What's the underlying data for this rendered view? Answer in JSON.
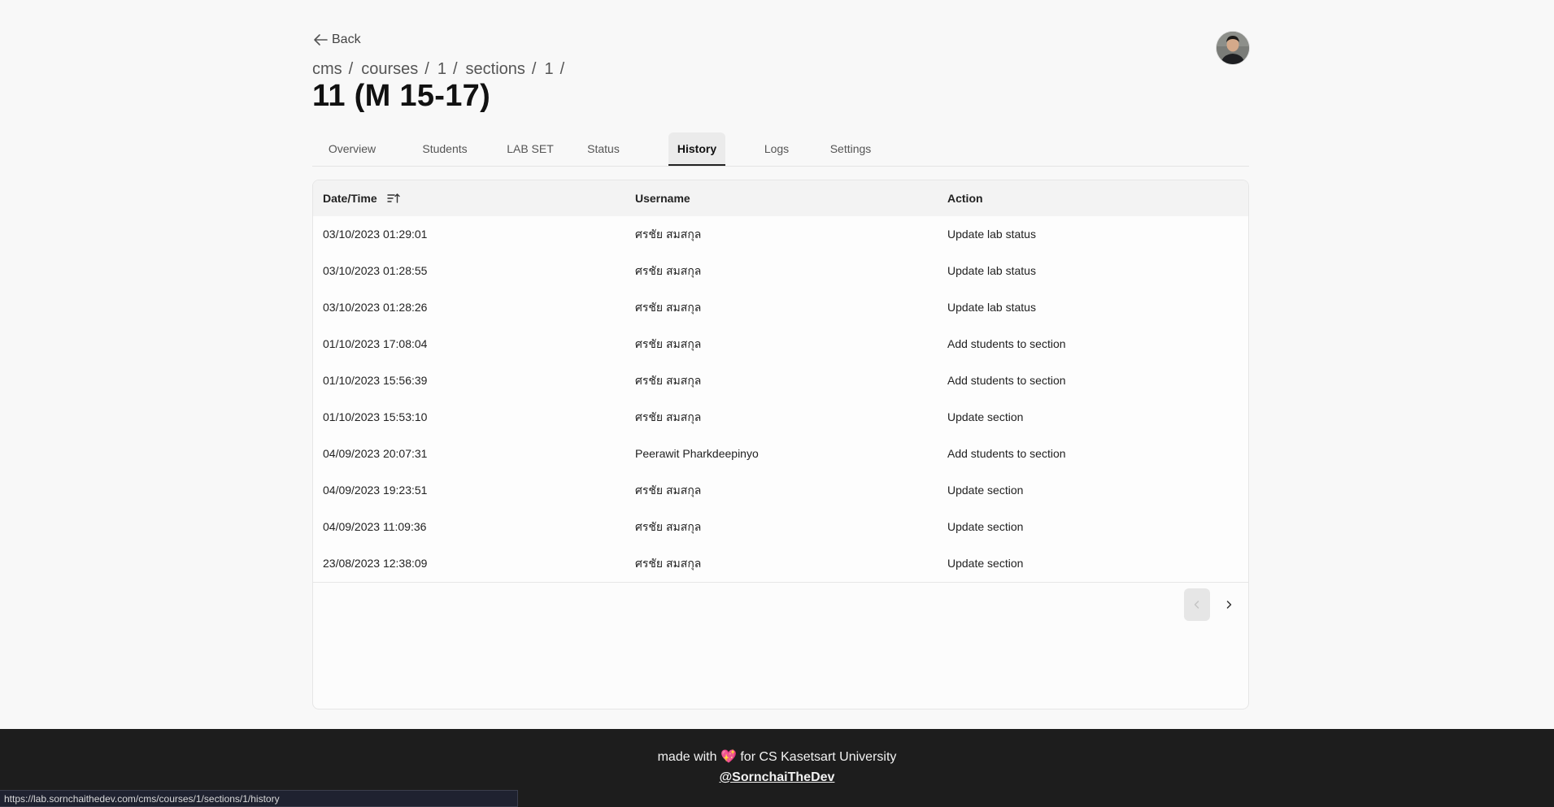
{
  "nav": {
    "back_label": "Back"
  },
  "breadcrumb": [
    {
      "label": "cms",
      "sep": "/"
    },
    {
      "label": "courses",
      "sep": "/"
    },
    {
      "label": "1",
      "sep": "/"
    },
    {
      "label": "sections",
      "sep": "/"
    },
    {
      "label": "1",
      "sep": "/"
    }
  ],
  "page_title": "11 (M 15-17)",
  "tabs": [
    {
      "label": "Overview",
      "active": false
    },
    {
      "label": "Students",
      "active": false
    },
    {
      "label": "LAB SET",
      "active": false
    },
    {
      "label": "Status",
      "active": false
    },
    {
      "label": "History",
      "active": true
    },
    {
      "label": "Logs",
      "active": false
    },
    {
      "label": "Settings",
      "active": false
    }
  ],
  "table": {
    "columns": [
      "Date/Time",
      "Username",
      "Action"
    ],
    "sort_icon": "sort-ascending-icon",
    "rows": [
      [
        "03/10/2023 01:29:01",
        "ศรชัย สมสกุล",
        "Update lab status"
      ],
      [
        "03/10/2023 01:28:55",
        "ศรชัย สมสกุล",
        "Update lab status"
      ],
      [
        "03/10/2023 01:28:26",
        "ศรชัย สมสกุล",
        "Update lab status"
      ],
      [
        "01/10/2023 17:08:04",
        "ศรชัย สมสกุล",
        "Add students to section"
      ],
      [
        "01/10/2023 15:56:39",
        "ศรชัย สมสกุล",
        "Add students to section"
      ],
      [
        "01/10/2023 15:53:10",
        "ศรชัย สมสกุล",
        "Update section"
      ],
      [
        "04/09/2023 20:07:31",
        "Peerawit Pharkdeepinyo",
        "Add students to section"
      ],
      [
        "04/09/2023 19:23:51",
        "ศรชัย สมสกุล",
        "Update section"
      ],
      [
        "04/09/2023 11:09:36",
        "ศรชัย สมสกุล",
        "Update section"
      ],
      [
        "23/08/2023 12:38:09",
        "ศรชัย สมสกุล",
        "Update section"
      ]
    ]
  },
  "pagination": {
    "prev_icon": "chevron-left-icon",
    "next_icon": "chevron-right-icon",
    "prev_disabled": true
  },
  "footer": {
    "prefix": "made with",
    "heart": "💖",
    "suffix": "for CS Kasetsart University",
    "link": "@SornchaiTheDev"
  },
  "statusbar": {
    "url": "https://lab.sornchaithedev.com/cms/courses/1/sections/1/history"
  },
  "colors": {
    "background": "#f8f8f8",
    "footer_bg": "#1d1d1d",
    "active_tab_bg": "#ebebeb",
    "table_header_bg": "#f3f3f3"
  }
}
